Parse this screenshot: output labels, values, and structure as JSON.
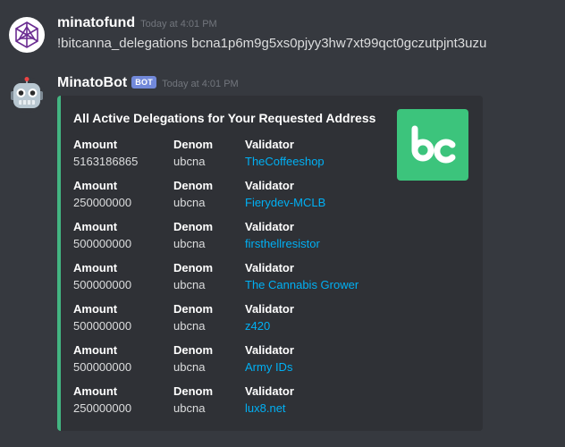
{
  "messages": [
    {
      "username": "minatofund",
      "timestamp": "Today at 4:01 PM",
      "content": "!bitcanna_delegations bcna1p6m9g5xs0pjyy3hw7xt99qct0gczutpjnt3uzu"
    },
    {
      "username": "MinatoBot",
      "badge": "BOT",
      "timestamp": "Today at 4:01 PM"
    }
  ],
  "embed": {
    "accent_color": "#43b581",
    "title": "All Active Delegations for Your Requested Address",
    "thumbnail_text": "bc",
    "field_labels": {
      "amount": "Amount",
      "denom": "Denom",
      "validator": "Validator"
    },
    "rows": [
      {
        "amount": "5163186865",
        "denom": "ubcna",
        "validator": "TheCoffeeshop"
      },
      {
        "amount": "250000000",
        "denom": "ubcna",
        "validator": "Fierydev-MCLB"
      },
      {
        "amount": "500000000",
        "denom": "ubcna",
        "validator": "firsthellresistor"
      },
      {
        "amount": "500000000",
        "denom": "ubcna",
        "validator": "The Cannabis Grower"
      },
      {
        "amount": "500000000",
        "denom": "ubcna",
        "validator": "z420"
      },
      {
        "amount": "500000000",
        "denom": "ubcna",
        "validator": "Army IDs"
      },
      {
        "amount": "250000000",
        "denom": "ubcna",
        "validator": "lux8.net"
      }
    ]
  }
}
